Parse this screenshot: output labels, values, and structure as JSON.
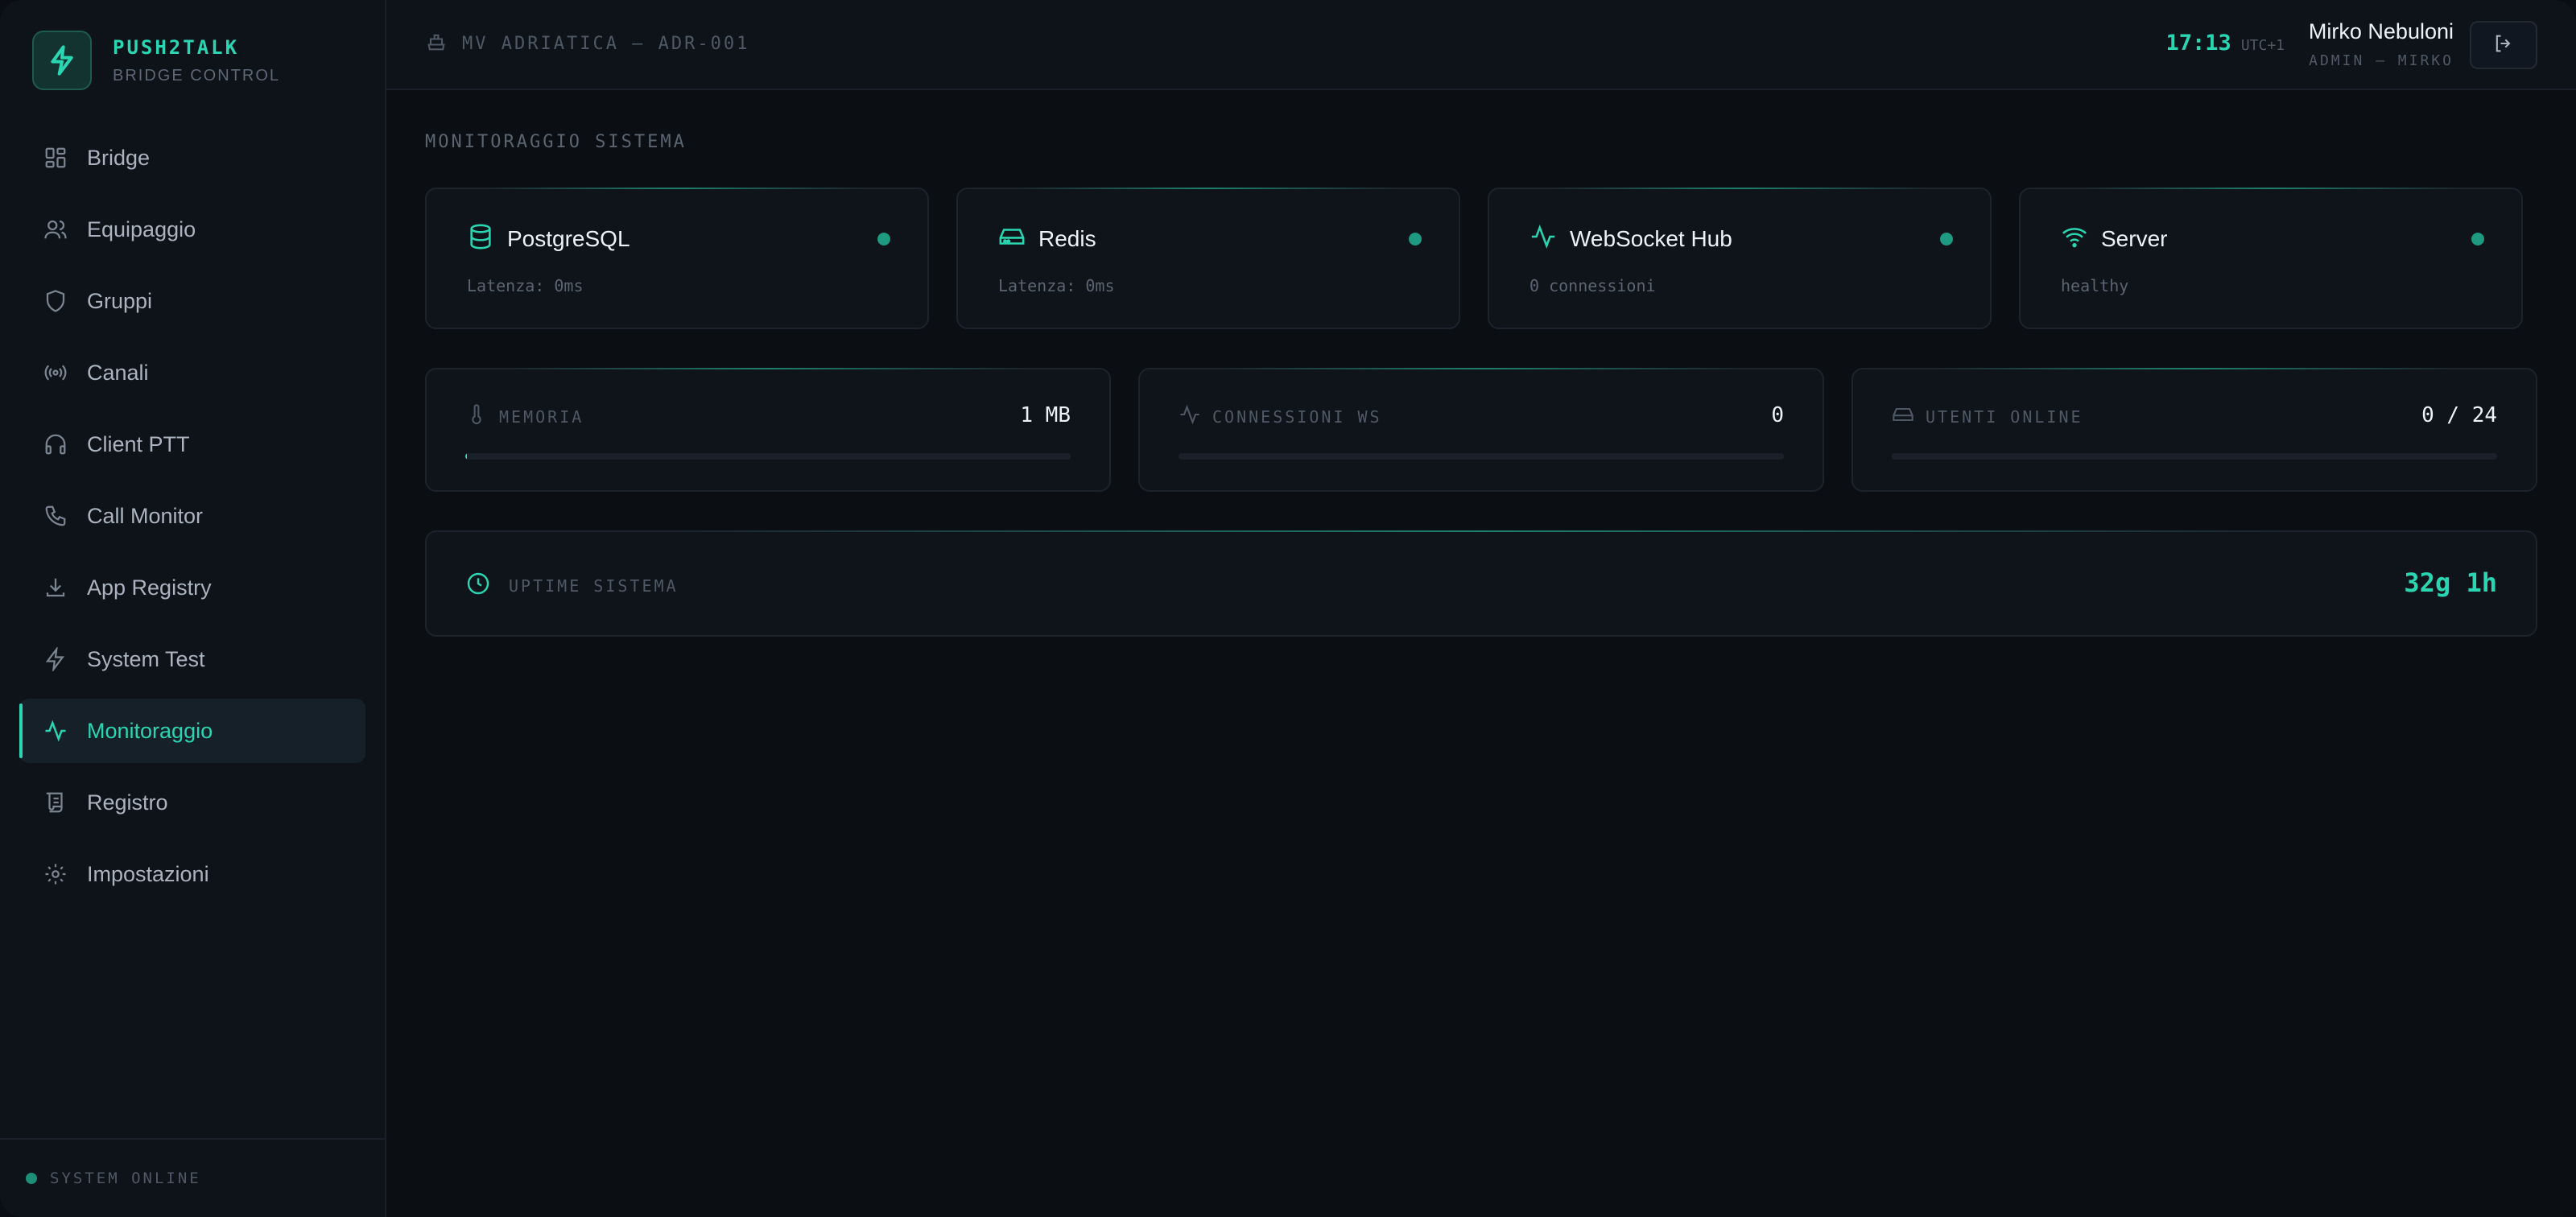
{
  "brand": {
    "name": "PUSH2TALK",
    "subtitle": "BRIDGE CONTROL"
  },
  "sidebar": {
    "items": [
      {
        "label": "Bridge",
        "icon": "dashboard-icon",
        "active": false
      },
      {
        "label": "Equipaggio",
        "icon": "users-icon",
        "active": false
      },
      {
        "label": "Gruppi",
        "icon": "shield-icon",
        "active": false
      },
      {
        "label": "Canali",
        "icon": "radio-icon",
        "active": false
      },
      {
        "label": "Client PTT",
        "icon": "headphones-icon",
        "active": false
      },
      {
        "label": "Call Monitor",
        "icon": "phone-icon",
        "active": false
      },
      {
        "label": "App Registry",
        "icon": "download-icon",
        "active": false
      },
      {
        "label": "System Test",
        "icon": "lightning-icon",
        "active": false
      },
      {
        "label": "Monitoraggio",
        "icon": "activity-icon",
        "active": true
      },
      {
        "label": "Registro",
        "icon": "scroll-icon",
        "active": false
      },
      {
        "label": "Impostazioni",
        "icon": "gear-icon",
        "active": false
      }
    ],
    "status": "SYSTEM ONLINE"
  },
  "header": {
    "vessel": "MV ADRIATICA — ADR-001",
    "time": "17:13",
    "timezone": "UTC+1",
    "user_name": "Mirko Nebuloni",
    "user_role": "ADMIN — MIRKO"
  },
  "main": {
    "section_title": "MONITORAGGIO SISTEMA",
    "services": [
      {
        "name": "PostgreSQL",
        "detail": "Latenza: 0ms",
        "icon": "database-icon"
      },
      {
        "name": "Redis",
        "detail": "Latenza: 0ms",
        "icon": "hard-drive-icon"
      },
      {
        "name": "WebSocket Hub",
        "detail": "0 connessioni",
        "icon": "activity-icon"
      },
      {
        "name": "Server",
        "detail": "healthy",
        "icon": "wifi-icon"
      }
    ],
    "metrics": [
      {
        "label": "MEMORIA",
        "value": "1 MB",
        "fill_percent": 0.3,
        "icon": "thermometer-icon"
      },
      {
        "label": "CONNESSIONI WS",
        "value": "0",
        "fill_percent": 0,
        "icon": "activity-icon"
      },
      {
        "label": "UTENTI ONLINE",
        "value": "0 / 24",
        "fill_percent": 0,
        "icon": "hard-drive-icon"
      }
    ],
    "uptime": {
      "label": "UPTIME SISTEMA",
      "value": "32g 1h",
      "icon": "clock-icon"
    }
  },
  "colors": {
    "accent": "#2ad6b2",
    "status_ok": "#1d9a80",
    "background": "#0b0e13"
  }
}
